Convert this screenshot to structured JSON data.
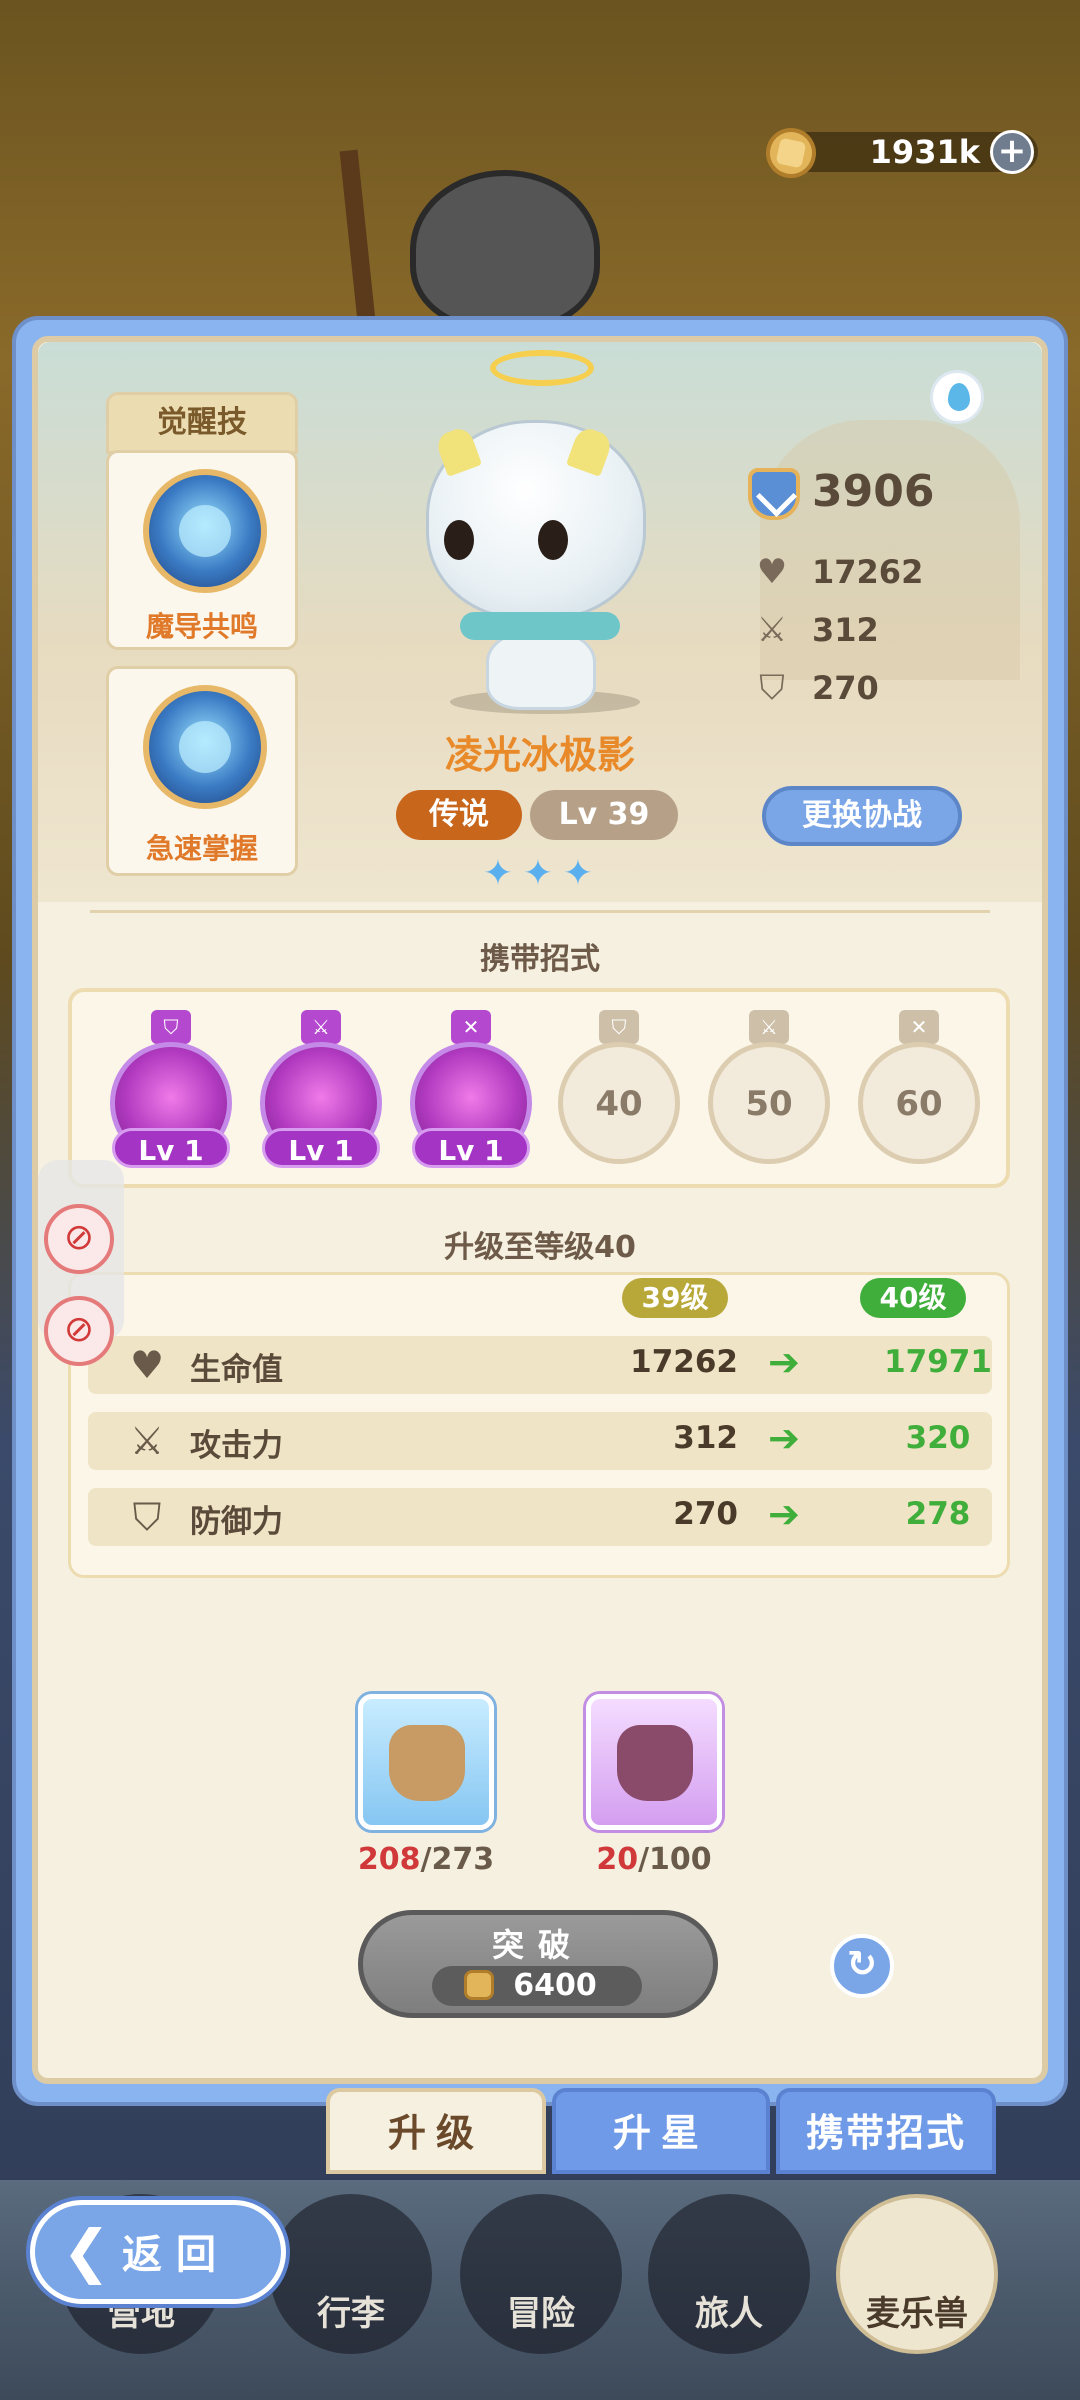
{
  "top_bar": {
    "coins": "1931k",
    "plus": "+"
  },
  "skills": {
    "header": "觉醒技",
    "items": [
      {
        "name": "魔导共鸣"
      },
      {
        "name": "急速掌握"
      }
    ]
  },
  "hero": {
    "name": "凌光冰极影",
    "rarity": "传说",
    "level": "Lv 39",
    "stars": [
      "✦",
      "✦",
      "✦"
    ],
    "power": "3906",
    "hp": "17262",
    "attack": "312",
    "defense": "270",
    "swap_label": "更换协战"
  },
  "moves": {
    "title": "携带招式",
    "slots": [
      {
        "state": "active",
        "label": "Lv 1"
      },
      {
        "state": "active",
        "label": "Lv 1"
      },
      {
        "state": "active",
        "label": "Lv 1"
      },
      {
        "state": "locked",
        "label": "40"
      },
      {
        "state": "locked",
        "label": "50"
      },
      {
        "state": "locked",
        "label": "60"
      }
    ]
  },
  "upgrade": {
    "title": "升级至等级40",
    "from_level": "39级",
    "to_level": "40级",
    "rows": [
      {
        "label": "生命值",
        "old": "17262",
        "new": "17971"
      },
      {
        "label": "攻击力",
        "old": "312",
        "new": "320"
      },
      {
        "label": "防御力",
        "old": "270",
        "new": "278"
      }
    ]
  },
  "items": [
    {
      "have": "208",
      "need": "/273"
    },
    {
      "have": "20",
      "need": "/100"
    }
  ],
  "breakthrough": {
    "label": "突破",
    "cost": "6400"
  },
  "tabs": [
    "升级",
    "升星",
    "携带招式"
  ],
  "nav": {
    "back_label": "返回",
    "items": [
      "营地",
      "行李",
      "冒险",
      "旅人",
      "麦乐兽"
    ]
  },
  "colors": {
    "accent_blue": "#7aa6e8",
    "legend_orange": "#c8661c",
    "gain_green": "#3fae3a"
  }
}
